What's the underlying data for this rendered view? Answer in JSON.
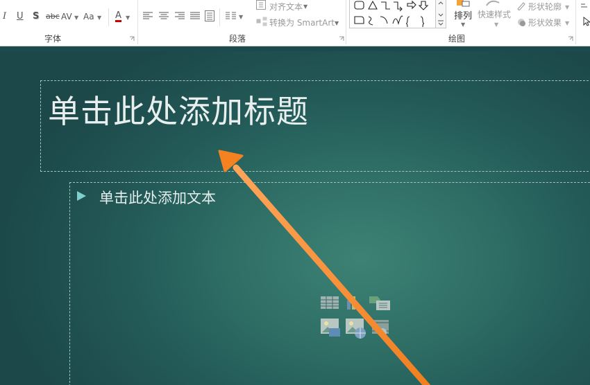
{
  "ribbon": {
    "font_group": {
      "label": "字体",
      "italic": "I",
      "underline": "U",
      "shadow": "S",
      "strike": "abc",
      "spacing": "AV",
      "change_case": "Aa",
      "font_color": "A"
    },
    "paragraph_group": {
      "label": "段落",
      "align_text": "对齐文本",
      "convert_smartart": "转换为 SmartArt"
    },
    "drawing_group": {
      "label": "绘图",
      "arrange": "排列",
      "quick_styles": "快速样式",
      "shape_outline": "形状轮廓",
      "shape_effects": "形状效果"
    }
  },
  "slide": {
    "title_placeholder": "单击此处添加标题",
    "body_placeholder": "单击此处添加文本"
  },
  "colors": {
    "annotation_arrow": "#f58220",
    "slide_bg_center": "#3d8275",
    "slide_bg_edge": "#1c4849"
  }
}
